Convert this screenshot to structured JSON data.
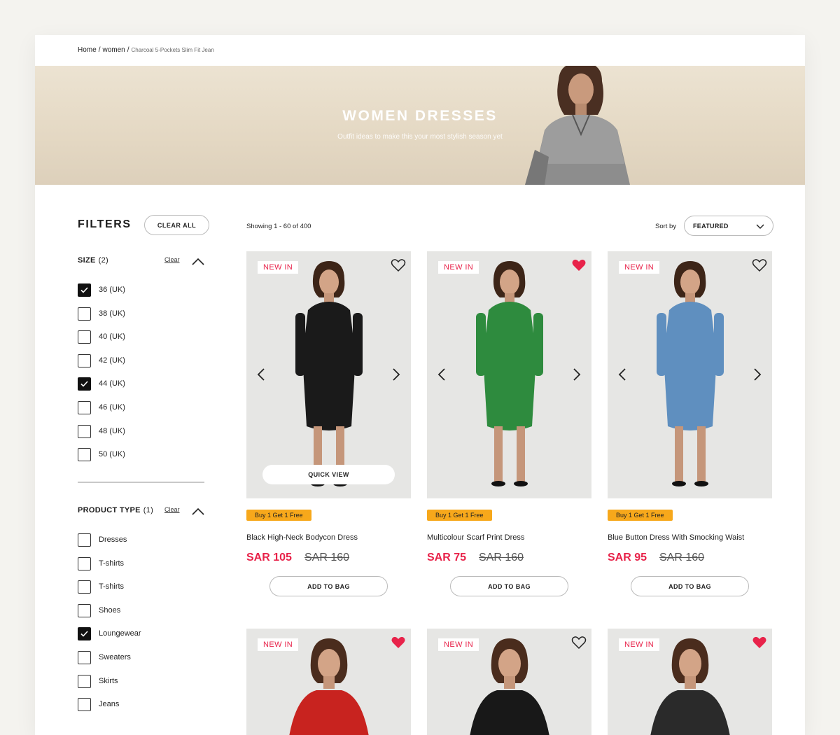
{
  "breadcrumb": {
    "home": "Home",
    "section": "women",
    "current": "Charcoal 5-Pockets Slim Fit Jean",
    "separator": "/"
  },
  "hero": {
    "title": "WOMEN DRESSES",
    "subtitle": "Outfit ideas to make this your most stylish season yet"
  },
  "filters": {
    "title": "FILTERS",
    "clear_all": "CLEAR ALL",
    "size": {
      "title": "SIZE",
      "count": "(2)",
      "clear": "Clear",
      "options": [
        {
          "label": "36 (UK)",
          "checked": true
        },
        {
          "label": "38 (UK)",
          "checked": false
        },
        {
          "label": "40 (UK)",
          "checked": false
        },
        {
          "label": "42 (UK)",
          "checked": false
        },
        {
          "label": "44 (UK)",
          "checked": true
        },
        {
          "label": "46 (UK)",
          "checked": false
        },
        {
          "label": "48 (UK)",
          "checked": false
        },
        {
          "label": "50 (UK)",
          "checked": false
        }
      ]
    },
    "product_type": {
      "title": "PRODUCT TYPE",
      "count": "(1)",
      "clear": "Clear",
      "options": [
        {
          "label": "Dresses",
          "checked": false
        },
        {
          "label": "T-shirts",
          "checked": false
        },
        {
          "label": "T-shirts",
          "checked": false
        },
        {
          "label": "Shoes",
          "checked": false
        },
        {
          "label": "Loungewear",
          "checked": true
        },
        {
          "label": "Sweaters",
          "checked": false
        },
        {
          "label": "Skirts",
          "checked": false
        },
        {
          "label": "Jeans",
          "checked": false
        }
      ]
    }
  },
  "listing": {
    "showing": "Showing 1 - 60 of 400",
    "sort_label": "Sort by",
    "sort_value": "FEATURED"
  },
  "labels": {
    "new_in": "NEW IN",
    "quick_view": "QUICK VIEW",
    "add_to_bag": "ADD TO BAG"
  },
  "products": [
    {
      "name": "Black High-Neck Bodycon Dress",
      "price": "SAR 105",
      "old_price": "SAR 160",
      "promo": "Buy 1 Get 1 Free",
      "favorited": false,
      "dress_color": "#1a1a1a"
    },
    {
      "name": "Multicolour Scarf Print Dress",
      "price": "SAR 75",
      "old_price": "SAR 160",
      "promo": "Buy 1 Get 1 Free",
      "favorited": true,
      "dress_color": "#2e8b3e"
    },
    {
      "name": "Blue Button Dress With Smocking Waist",
      "price": "SAR 95",
      "old_price": "SAR 160",
      "promo": "Buy 1 Get 1 Free",
      "favorited": false,
      "dress_color": "#5f8fbf"
    },
    {
      "favorited": true,
      "dress_color": "#c8231f"
    },
    {
      "favorited": false,
      "dress_color": "#181818"
    },
    {
      "favorited": true,
      "dress_color": "#2a2a2a"
    }
  ],
  "colors": {
    "accent": "#e8234a",
    "promo": "#f7a81b",
    "hero_bg": "#e6dbc7"
  }
}
